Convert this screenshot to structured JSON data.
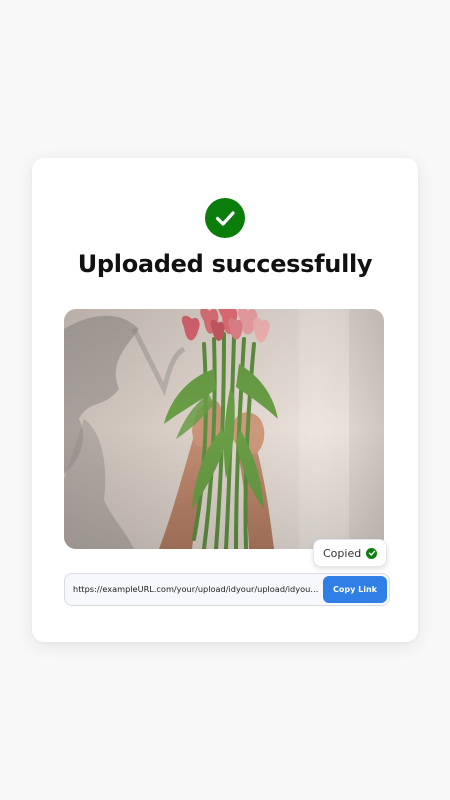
{
  "status": {
    "title": "Uploaded successfully",
    "icon": "check-circle-icon",
    "accent_color": "#0a7d0a"
  },
  "image": {
    "description_icon": "uploaded-photo"
  },
  "tooltip": {
    "label": "Copied",
    "icon": "check-circle-icon"
  },
  "link": {
    "url": "https://exampleURL.com/your/upload/idyour/upload/idyour/upload/id",
    "button_label": "Copy Link",
    "button_color": "#2f7fe6"
  }
}
